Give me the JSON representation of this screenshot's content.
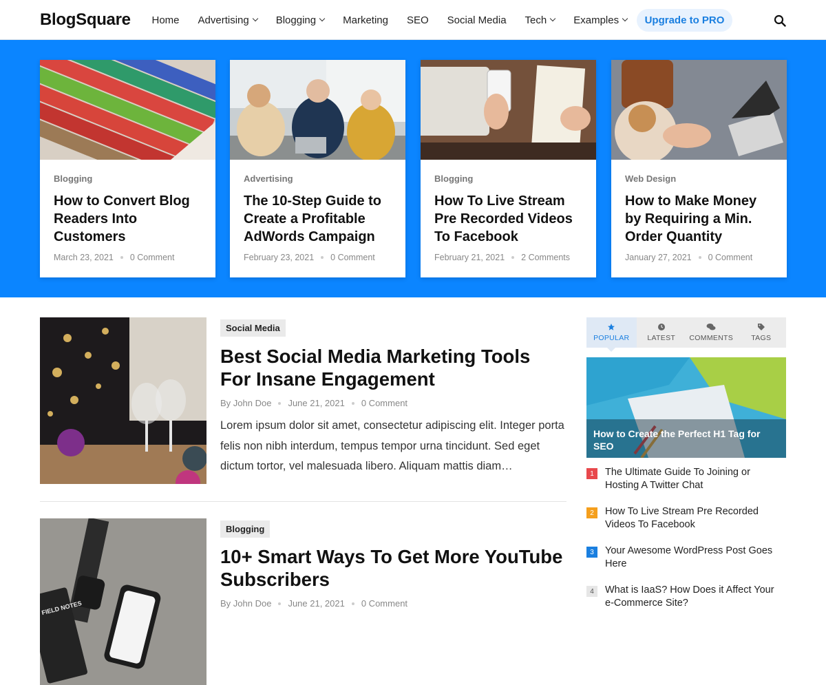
{
  "header": {
    "logo": "BlogSquare",
    "nav": [
      {
        "label": "Home",
        "dropdown": false
      },
      {
        "label": "Advertising",
        "dropdown": true
      },
      {
        "label": "Blogging",
        "dropdown": true
      },
      {
        "label": "Marketing",
        "dropdown": false
      },
      {
        "label": "SEO",
        "dropdown": false
      },
      {
        "label": "Social Media",
        "dropdown": false
      },
      {
        "label": "Tech",
        "dropdown": true
      },
      {
        "label": "Examples",
        "dropdown": true
      }
    ],
    "pro_label": "Upgrade to PRO",
    "search_icon": "search-icon"
  },
  "colors": {
    "accent": "#0b85ff",
    "pro_text": "#1a7fe0",
    "rank_1": "#e8484c",
    "rank_2": "#f59f1c",
    "rank_3": "#1a7fe0",
    "rank_4": "#e6e6e6"
  },
  "featured": [
    {
      "category": "Blogging",
      "title": "How to Convert Blog Readers Into Customers",
      "date": "March 23, 2021",
      "comments": "0 Comment"
    },
    {
      "category": "Advertising",
      "title": "The 10-Step Guide to Create a Profitable AdWords Campaign",
      "date": "February 23, 2021",
      "comments": "0 Comment"
    },
    {
      "category": "Blogging",
      "title": "How To Live Stream Pre Recorded Videos To Facebook",
      "date": "February 21, 2021",
      "comments": "2 Comments"
    },
    {
      "category": "Web Design",
      "title": "How to Make Money by Requiring a Min. Order Quantity",
      "date": "January 27, 2021",
      "comments": "0 Comment"
    }
  ],
  "posts": [
    {
      "category": "Social Media",
      "title": "Best Social Media Marketing Tools For Insane Engagement",
      "author": "By John Doe",
      "date": "June 21, 2021",
      "comments": "0 Comment",
      "excerpt": "Lorem ipsum dolor sit amet, consectetur adipiscing elit. Integer porta felis non nibh interdum, tempus tempor urna tincidunt. Sed eget dictum tortor, vel malesuada libero. Aliquam mattis diam…"
    },
    {
      "category": "Blogging",
      "title": "10+ Smart Ways To Get More YouTube Subscribers",
      "author": "By John Doe",
      "date": "June 21, 2021",
      "comments": "0 Comment",
      "image_text": "FIELD NOTES"
    }
  ],
  "sidebar": {
    "tabs": [
      {
        "label": "POPULAR",
        "icon": "star-icon",
        "active": true
      },
      {
        "label": "LATEST",
        "icon": "clock-icon",
        "active": false
      },
      {
        "label": "COMMENTS",
        "icon": "comments-icon",
        "active": false
      },
      {
        "label": "TAGS",
        "icon": "tag-icon",
        "active": false
      }
    ],
    "featured_title": "How to Create the Perfect H1 Tag for SEO",
    "popular": [
      {
        "rank": "1",
        "title": "The Ultimate Guide To Joining or Hosting A Twitter Chat"
      },
      {
        "rank": "2",
        "title": "How To Live Stream Pre Recorded Videos To Facebook"
      },
      {
        "rank": "3",
        "title": "Your Awesome WordPress Post Goes Here"
      },
      {
        "rank": "4",
        "title": "What is IaaS? How Does it Affect Your e-Commerce Site?"
      }
    ]
  }
}
